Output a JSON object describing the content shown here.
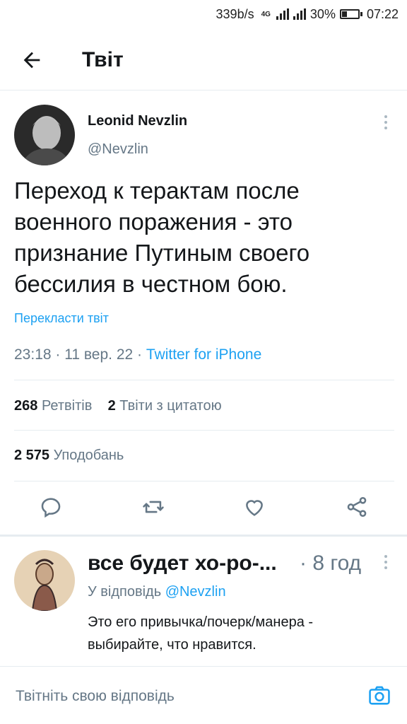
{
  "status_bar": {
    "speed": "339b/s",
    "network": "4G",
    "battery": "30%",
    "time": "07:22"
  },
  "header": {
    "title": "Твіт"
  },
  "tweet": {
    "author_name": "Leonid Nevzlin",
    "author_handle": "@Nevzlin",
    "text": "Переход к терактам после военного поражения - это признание Путиным своего бессилия в честном бою.",
    "translate_label": "Перекласти твіт",
    "time": "23:18",
    "date": "11 вер. 22",
    "source": "Twitter for iPhone",
    "retweets_count": "268",
    "retweets_label": "Ретвітів",
    "quotes_count": "2",
    "quotes_label": "Твіти з цитатою",
    "likes_count": "2 575",
    "likes_label": "Уподобань"
  },
  "reply": {
    "name": "все будет хо-ро-...",
    "time": "· 8 год",
    "reply_to_label": "У відповідь",
    "reply_to_handle": "@Nevzlin",
    "text": "Это его привычка/почерк/манера - выбирайте, что нравится."
  },
  "compose": {
    "placeholder": "Твітніть свою відповідь"
  },
  "colors": {
    "accent": "#1da1f2",
    "secondary_text": "#657786",
    "primary_text": "#14171a",
    "divider": "#e6ecf0"
  },
  "icons": {
    "back": "arrow-left-icon",
    "more": "more-vertical-icon",
    "reply": "comment-icon",
    "retweet": "retweet-icon",
    "like": "heart-icon",
    "share": "share-icon",
    "camera": "camera-icon"
  }
}
